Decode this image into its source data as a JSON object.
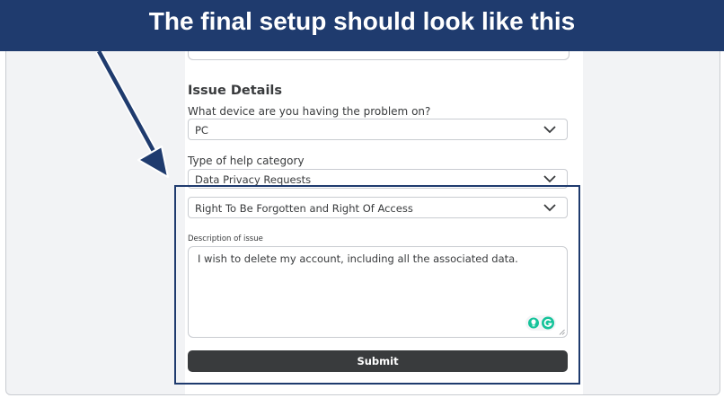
{
  "banner": {
    "text": "The final setup should look like this"
  },
  "form": {
    "section_title": "Issue Details",
    "device": {
      "label": "What device are you having the problem on?",
      "value": "PC"
    },
    "help_category": {
      "label": "Type of help category",
      "value": "Data Privacy Requests"
    },
    "sub_category": {
      "value": "Right To Be Forgotten and Right Of Access"
    },
    "description": {
      "label": "Description of issue",
      "value": "I wish to delete my account, including all the associated data."
    },
    "submit_label": "Submit"
  },
  "icons": {
    "chevron": "chevron-down-icon",
    "grammarly": "grammarly-icon",
    "lightbulb": "lightbulb-icon"
  },
  "colors": {
    "banner": "#1f3b6e",
    "button": "#393b3d",
    "accent_green": "#15c39a"
  }
}
